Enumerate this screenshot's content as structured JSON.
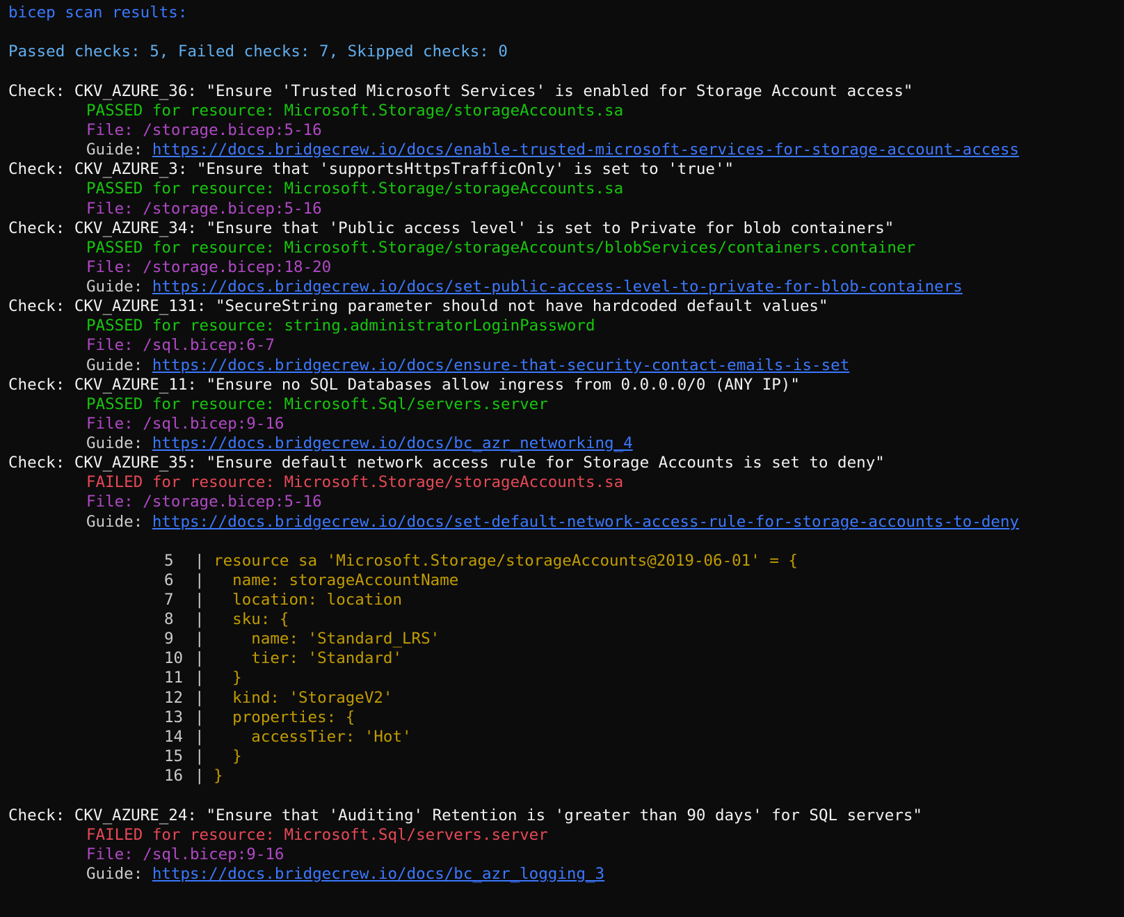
{
  "terminal": {
    "header": "bicep scan results:",
    "summary": "Passed checks: 5, Failed checks: 7, Skipped checks: 0",
    "checks": [
      {
        "check": "Check: CKV_AZURE_36: \"Ensure 'Trusted Microsoft Services' is enabled for Storage Account access\"",
        "result": "PASSED for resource: Microsoft.Storage/storageAccounts.sa",
        "file": "File: /storage.bicep:5-16",
        "guide_label": "Guide: ",
        "guide_url": "https://docs.bridgecrew.io/docs/enable-trusted-microsoft-services-for-storage-account-access"
      },
      {
        "check": "Check: CKV_AZURE_3: \"Ensure that 'supportsHttpsTrafficOnly' is set to 'true'\"",
        "result": "PASSED for resource: Microsoft.Storage/storageAccounts.sa",
        "file": "File: /storage.bicep:5-16"
      },
      {
        "check": "Check: CKV_AZURE_34: \"Ensure that 'Public access level' is set to Private for blob containers\"",
        "result": "PASSED for resource: Microsoft.Storage/storageAccounts/blobServices/containers.container",
        "file": "File: /storage.bicep:18-20",
        "guide_label": "Guide: ",
        "guide_url": "https://docs.bridgecrew.io/docs/set-public-access-level-to-private-for-blob-containers"
      },
      {
        "check": "Check: CKV_AZURE_131: \"SecureString parameter should not have hardcoded default values\"",
        "result": "PASSED for resource: string.administratorLoginPassword",
        "file": "File: /sql.bicep:6-7",
        "guide_label": "Guide: ",
        "guide_url": "https://docs.bridgecrew.io/docs/ensure-that-security-contact-emails-is-set"
      },
      {
        "check": "Check: CKV_AZURE_11: \"Ensure no SQL Databases allow ingress from 0.0.0.0/0 (ANY IP)\"",
        "result": "PASSED for resource: Microsoft.Sql/servers.server",
        "file": "File: /sql.bicep:9-16",
        "guide_label": "Guide: ",
        "guide_url": "https://docs.bridgecrew.io/docs/bc_azr_networking_4"
      },
      {
        "check": "Check: CKV_AZURE_35: \"Ensure default network access rule for Storage Accounts is set to deny\"",
        "result": "FAILED for resource: Microsoft.Storage/storageAccounts.sa",
        "file": "File: /storage.bicep:5-16",
        "guide_label": "Guide: ",
        "guide_url": "https://docs.bridgecrew.io/docs/set-default-network-access-rule-for-storage-accounts-to-deny"
      },
      {
        "check": "Check: CKV_AZURE_24: \"Ensure that 'Auditing' Retention is 'greater than 90 days' for SQL servers\"",
        "result": "FAILED for resource: Microsoft.Sql/servers.server",
        "file": "File: /sql.bicep:9-16",
        "guide_label": "Guide: ",
        "guide_url": "https://docs.bridgecrew.io/docs/bc_azr_logging_3"
      }
    ],
    "code_block": [
      {
        "num": "5",
        "bar": "|",
        "text": " resource sa 'Microsoft.Storage/storageAccounts@2019-06-01' = {"
      },
      {
        "num": "6",
        "bar": "|",
        "text": "   name: storageAccountName"
      },
      {
        "num": "7",
        "bar": "|",
        "text": "   location: location"
      },
      {
        "num": "8",
        "bar": "|",
        "text": "   sku: {"
      },
      {
        "num": "9",
        "bar": "|",
        "text": "     name: 'Standard_LRS'"
      },
      {
        "num": "10",
        "bar": "|",
        "text": "     tier: 'Standard'"
      },
      {
        "num": "11",
        "bar": "|",
        "text": "   }"
      },
      {
        "num": "12",
        "bar": "|",
        "text": "   kind: 'StorageV2'"
      },
      {
        "num": "13",
        "bar": "|",
        "text": "   properties: {"
      },
      {
        "num": "14",
        "bar": "|",
        "text": "     accessTier: 'Hot'"
      },
      {
        "num": "15",
        "bar": "|",
        "text": "   }"
      },
      {
        "num": "16",
        "bar": "|",
        "text": " }"
      }
    ],
    "colors": {
      "background": "#0c0c0c",
      "header": "#3b78ff",
      "summary": "#61aeee",
      "passed": "#16c60c",
      "failed": "#e74856",
      "file": "#b148c6",
      "code": "#c19c00",
      "link": "#3b78ff"
    }
  }
}
